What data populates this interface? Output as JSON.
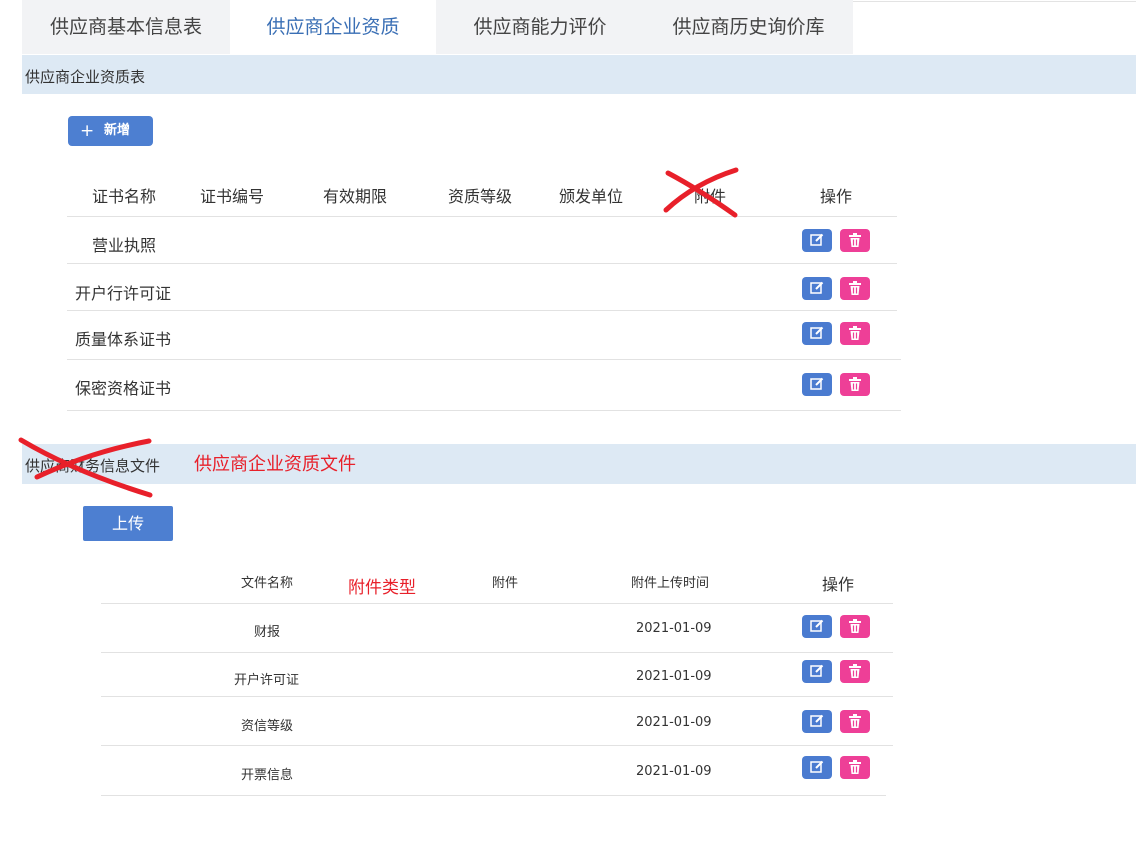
{
  "tabs": [
    {
      "label": "供应商基本信息表"
    },
    {
      "label": "供应商企业资质"
    },
    {
      "label": "供应商能力评价"
    },
    {
      "label": "供应商历史询价库"
    }
  ],
  "active_tab": 1,
  "qualification": {
    "section_title": "供应商企业资质表",
    "add_button": "新增",
    "columns": [
      "证书名称",
      "证书编号",
      "有效期限",
      "资质等级",
      "颁发单位",
      "附件",
      "操作"
    ],
    "rows": [
      {
        "name": "营业执照"
      },
      {
        "name": "开户行许可证"
      },
      {
        "name": "质量体系证书"
      },
      {
        "name": "保密资格证书"
      }
    ]
  },
  "files": {
    "section_title": "供应商财务信息文件",
    "annotation_title": "供应商企业资质文件",
    "upload_button": "上传",
    "columns": [
      "文件名称",
      "附件",
      "附件上传时间",
      "操作"
    ],
    "column_annotation": "附件类型",
    "rows": [
      {
        "name": "财报",
        "upload_time": "2021-01-09"
      },
      {
        "name": "开户许可证",
        "upload_time": "2021-01-09"
      },
      {
        "name": "资信等级",
        "upload_time": "2021-01-09"
      },
      {
        "name": "开票信息",
        "upload_time": "2021-01-09"
      }
    ]
  },
  "colors": {
    "accent": "#4d7fd1",
    "edit_button": "#4a7bd0",
    "delete_button": "#ee3f97",
    "section_bg": "#dde9f4",
    "annotation_red": "#e8202a"
  },
  "icons": {
    "add": "plus-icon",
    "edit": "edit-icon",
    "delete": "trash-icon"
  }
}
